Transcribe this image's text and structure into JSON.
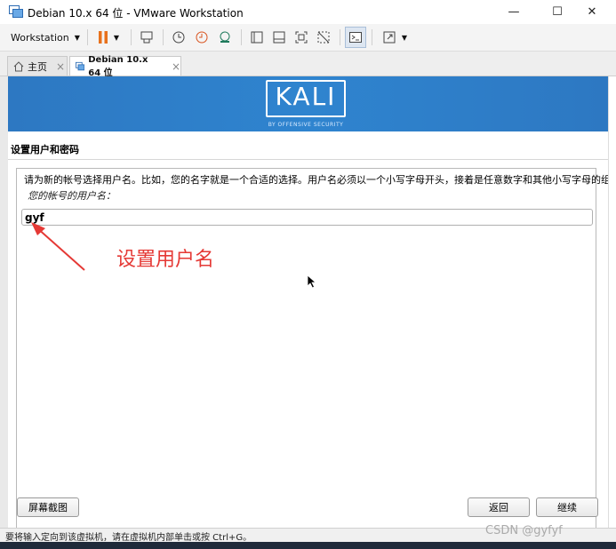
{
  "window": {
    "title": "Debian 10.x 64 位 - VMware Workstation",
    "controls": {
      "minimize": "—",
      "maximize": "☐",
      "close": "✕"
    }
  },
  "toolbar": {
    "menu_label": "Workstation",
    "icons": [
      "pause-icon",
      "send-keys-icon",
      "snapshot-icon",
      "revert-snapshot-icon",
      "snapshot-manager-icon",
      "single-view-icon",
      "multi-view-icon",
      "fit-guest-icon",
      "unity-icon",
      "console-view-icon",
      "full-screen-icon"
    ]
  },
  "tabs": [
    {
      "label": "主页",
      "icon": "home-icon"
    },
    {
      "label": "Debian 10.x 64 位",
      "icon": "vm-icon",
      "active": true
    }
  ],
  "installer": {
    "logo": "KALI",
    "tagline": "BY OFFENSIVE SECURITY",
    "step_title": "设置用户和密码",
    "instruction": "请为新的帐号选择用户名。比如，您的名字就是一个合适的选择。用户名必须以一个小写字母开头，接着是任意数字和其他小写字母的组合。",
    "field_label": "您的帐号的用户名：",
    "username_value": "gyf",
    "annotation": "设置用户名",
    "buttons": {
      "screenshot": "屏幕截图",
      "back": "返回",
      "continue": "继续"
    }
  },
  "statusbar": {
    "text": "要将输入定向到该虚拟机，请在虚拟机内部单击或按 Ctrl+G。",
    "watermark": "CSDN @gyfyf"
  },
  "colors": {
    "banner": "#2f84cf",
    "annotation": "#e53935",
    "pause": "#e8711c"
  }
}
